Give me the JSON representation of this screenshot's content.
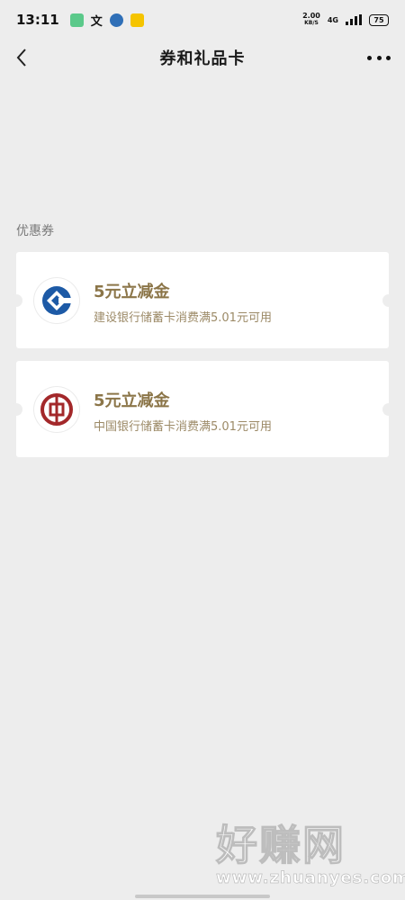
{
  "status_bar": {
    "time": "13:11",
    "net_speed_value": "2.00",
    "net_speed_unit": "KB/S",
    "network": "4G",
    "battery": "75"
  },
  "header": {
    "title": "券和礼品卡"
  },
  "section": {
    "label": "优惠券"
  },
  "coupons": [
    {
      "title": "5元立减金",
      "description": "建设银行储蓄卡消费满5.01元可用",
      "bank_icon": "ccb-logo-icon",
      "color": "#1d5aa6"
    },
    {
      "title": "5元立减金",
      "description": "中国银行储蓄卡消费满5.01元可用",
      "bank_icon": "boc-logo-icon",
      "color": "#a3282a"
    }
  ],
  "watermark": {
    "text": "好赚网",
    "url": "www.zhuanyes.com"
  },
  "colors": {
    "background": "#ededed",
    "coupon_title": "#8b7548",
    "coupon_desc": "#9c8a67"
  }
}
